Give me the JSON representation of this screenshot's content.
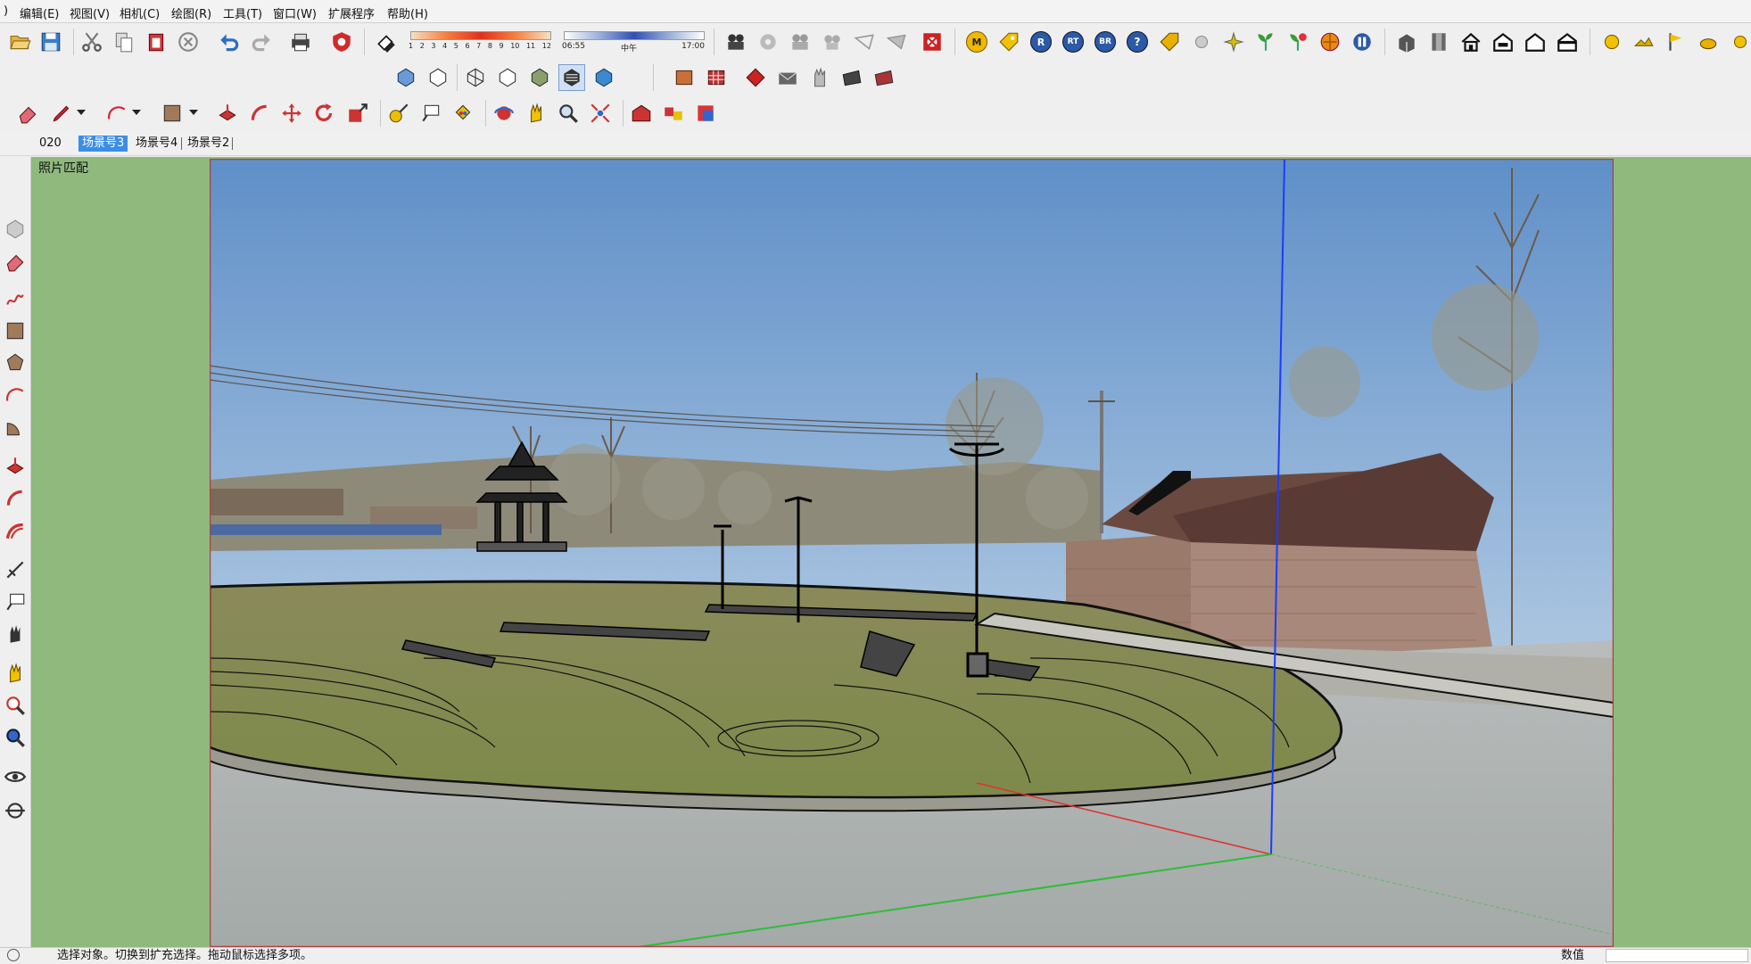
{
  "menu": [
    "编辑(E)",
    "视图(V)",
    "相机(C)",
    "绘图(R)",
    "工具(T)",
    "窗口(W)",
    "扩展程序",
    "帮助(H)"
  ],
  "shadow": {
    "months": [
      "1",
      "2",
      "3",
      "4",
      "5",
      "6",
      "7",
      "8",
      "9",
      "10",
      "11",
      "12"
    ],
    "time_start": "06:55",
    "time_mid": "中午",
    "time_end": "17:00"
  },
  "plugin_badges": [
    "M",
    "R",
    "RT",
    "BR",
    "?"
  ],
  "scene_tabs": [
    {
      "label": "020",
      "active": false
    },
    {
      "label": "场景号3",
      "active": true
    },
    {
      "label": "场景号4",
      "active": false
    },
    {
      "label": "场景号2",
      "active": false
    }
  ],
  "viewport": {
    "label": "照片匹配"
  },
  "status": {
    "hint": "选择对象。切换到扩充选择。拖动鼠标选择多项。",
    "measure_label": "数值"
  },
  "colors": {
    "viewport_bg": "#8fb97d",
    "active_tab": "#3a8ee6",
    "axis_blue": "#1a3cff",
    "axis_red": "#e23030",
    "axis_green": "#2dbd3a"
  }
}
